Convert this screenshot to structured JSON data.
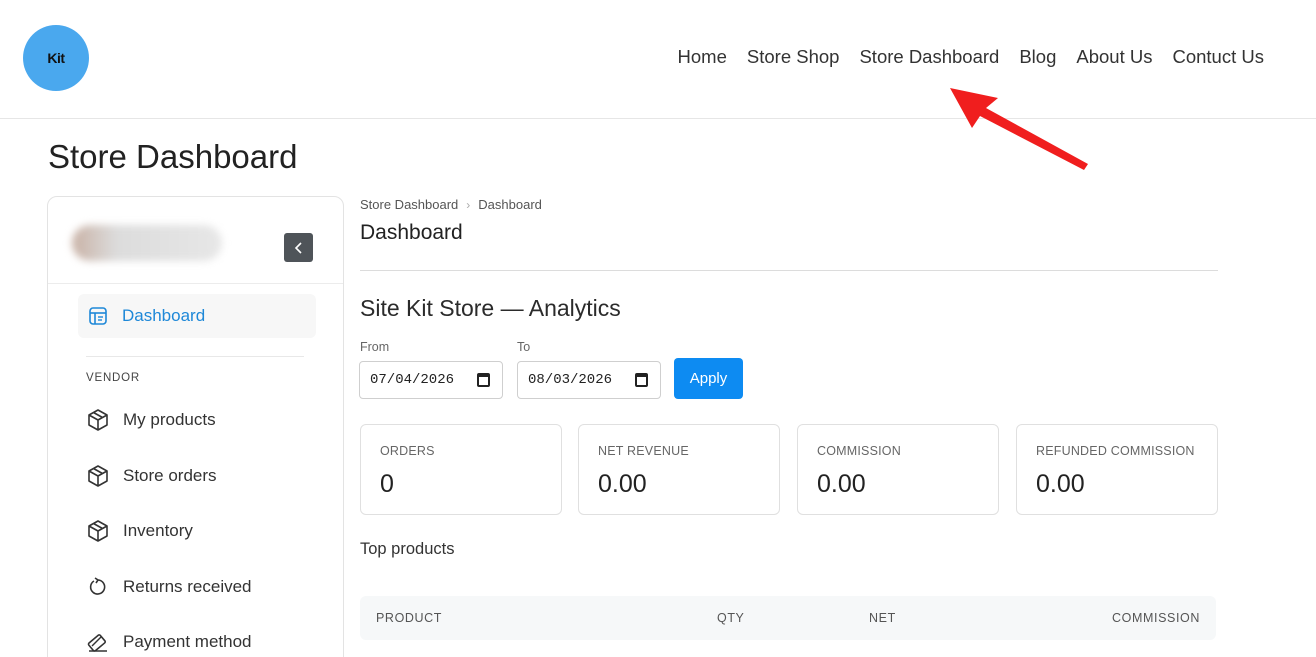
{
  "header": {
    "logo_text": "Kit",
    "nav": [
      "Home",
      "Store Shop",
      "Store Dashboard",
      "Blog",
      "About Us",
      "Contuct Us"
    ],
    "accent_color": "#4aa8ee"
  },
  "page_title": "Store Dashboard",
  "sidebar": {
    "collapse_icon": "chevron-left-icon",
    "active_item": {
      "label": "Dashboard",
      "icon": "dashboard-icon"
    },
    "section_label": "VENDOR",
    "items": [
      {
        "label": "My products",
        "icon": "box-icon"
      },
      {
        "label": "Store orders",
        "icon": "box-icon"
      },
      {
        "label": "Inventory",
        "icon": "box-icon"
      },
      {
        "label": "Returns received",
        "icon": "refresh-icon"
      },
      {
        "label": "Payment method",
        "icon": "card-icon"
      }
    ]
  },
  "main": {
    "breadcrumb": [
      "Store Dashboard",
      "Dashboard"
    ],
    "title": "Dashboard",
    "analytics_title": "Site Kit Store — Analytics",
    "from_label": "From",
    "from_value": "07/04/2026",
    "to_label": "To",
    "to_value": "08/03/2026",
    "apply_label": "Apply",
    "cards": [
      {
        "label": "ORDERS",
        "value": "0"
      },
      {
        "label": "NET REVENUE",
        "value": "0.00"
      },
      {
        "label": "COMMISSION",
        "value": "0.00"
      },
      {
        "label": "REFUNDED COMMISSION",
        "value": "0.00"
      }
    ],
    "top_products_label": "Top products",
    "table_columns": [
      "PRODUCT",
      "QTY",
      "NET",
      "COMMISSION"
    ]
  },
  "colors": {
    "primary_button": "#0d8bf2",
    "active_link": "#1e88d8",
    "annotation_arrow": "#f01e1e"
  }
}
